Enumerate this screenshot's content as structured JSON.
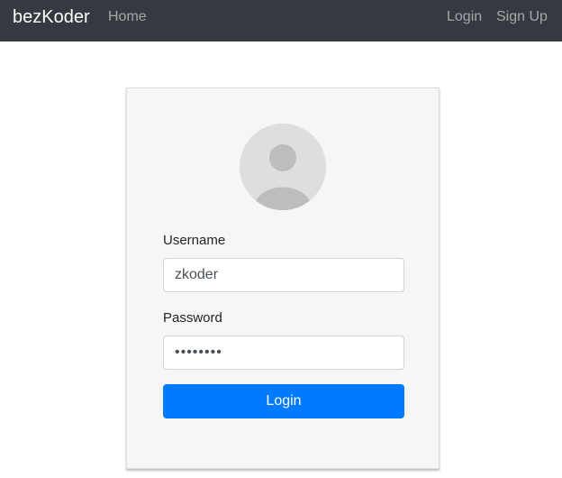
{
  "navbar": {
    "brand": "bezKoder",
    "home": "Home",
    "login": "Login",
    "signup": "Sign Up",
    "background": "#343a40"
  },
  "login_card": {
    "avatar_icon": "user-profile-icon",
    "username_label": "Username",
    "username_value": "zkoder",
    "password_label": "Password",
    "password_value": "••••••••",
    "submit_label": "Login",
    "accent": "#007bff"
  }
}
